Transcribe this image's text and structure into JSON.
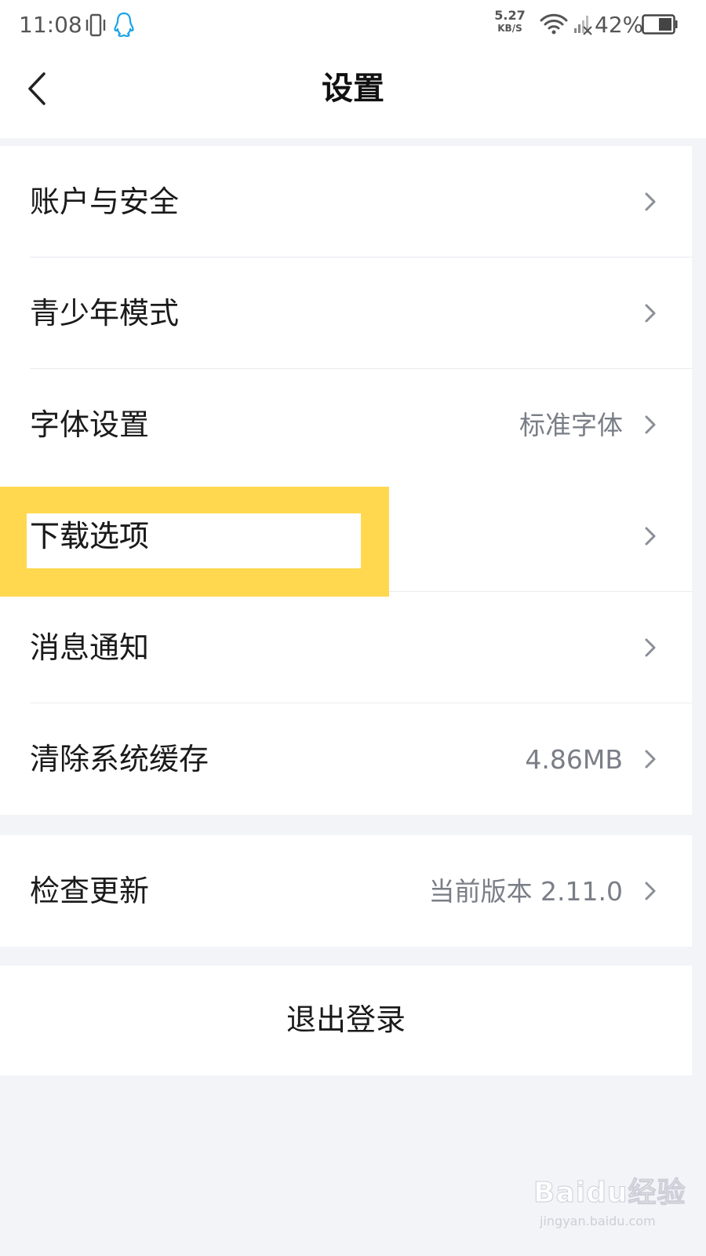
{
  "status_bar": {
    "time": "11:08",
    "net_speed_value": "5.27",
    "net_speed_unit": "KB/S",
    "battery": "42%"
  },
  "header": {
    "title": "设置",
    "back_icon": "chevron-left-icon"
  },
  "groups": [
    {
      "items": [
        {
          "label": "账户与安全",
          "value": ""
        },
        {
          "label": "青少年模式",
          "value": ""
        },
        {
          "label": "字体设置",
          "value": "标准字体"
        }
      ]
    },
    {
      "items": [
        {
          "label": "下载选项",
          "value": ""
        },
        {
          "label": "消息通知",
          "value": ""
        },
        {
          "label": "清除系统缓存",
          "value": "4.86MB"
        }
      ]
    },
    {
      "items": [
        {
          "label": "检查更新",
          "value": "当前版本 2.11.0"
        }
      ]
    }
  ],
  "logout": {
    "label": "退出登录"
  },
  "watermark": {
    "main": "Baidu经验",
    "sub": "jingyan.baidu.com"
  },
  "colors": {
    "background": "#f2f4f8",
    "highlight": "#ffd84f",
    "value_text": "#7a7e86",
    "qq_blue": "#1aa3e8"
  }
}
